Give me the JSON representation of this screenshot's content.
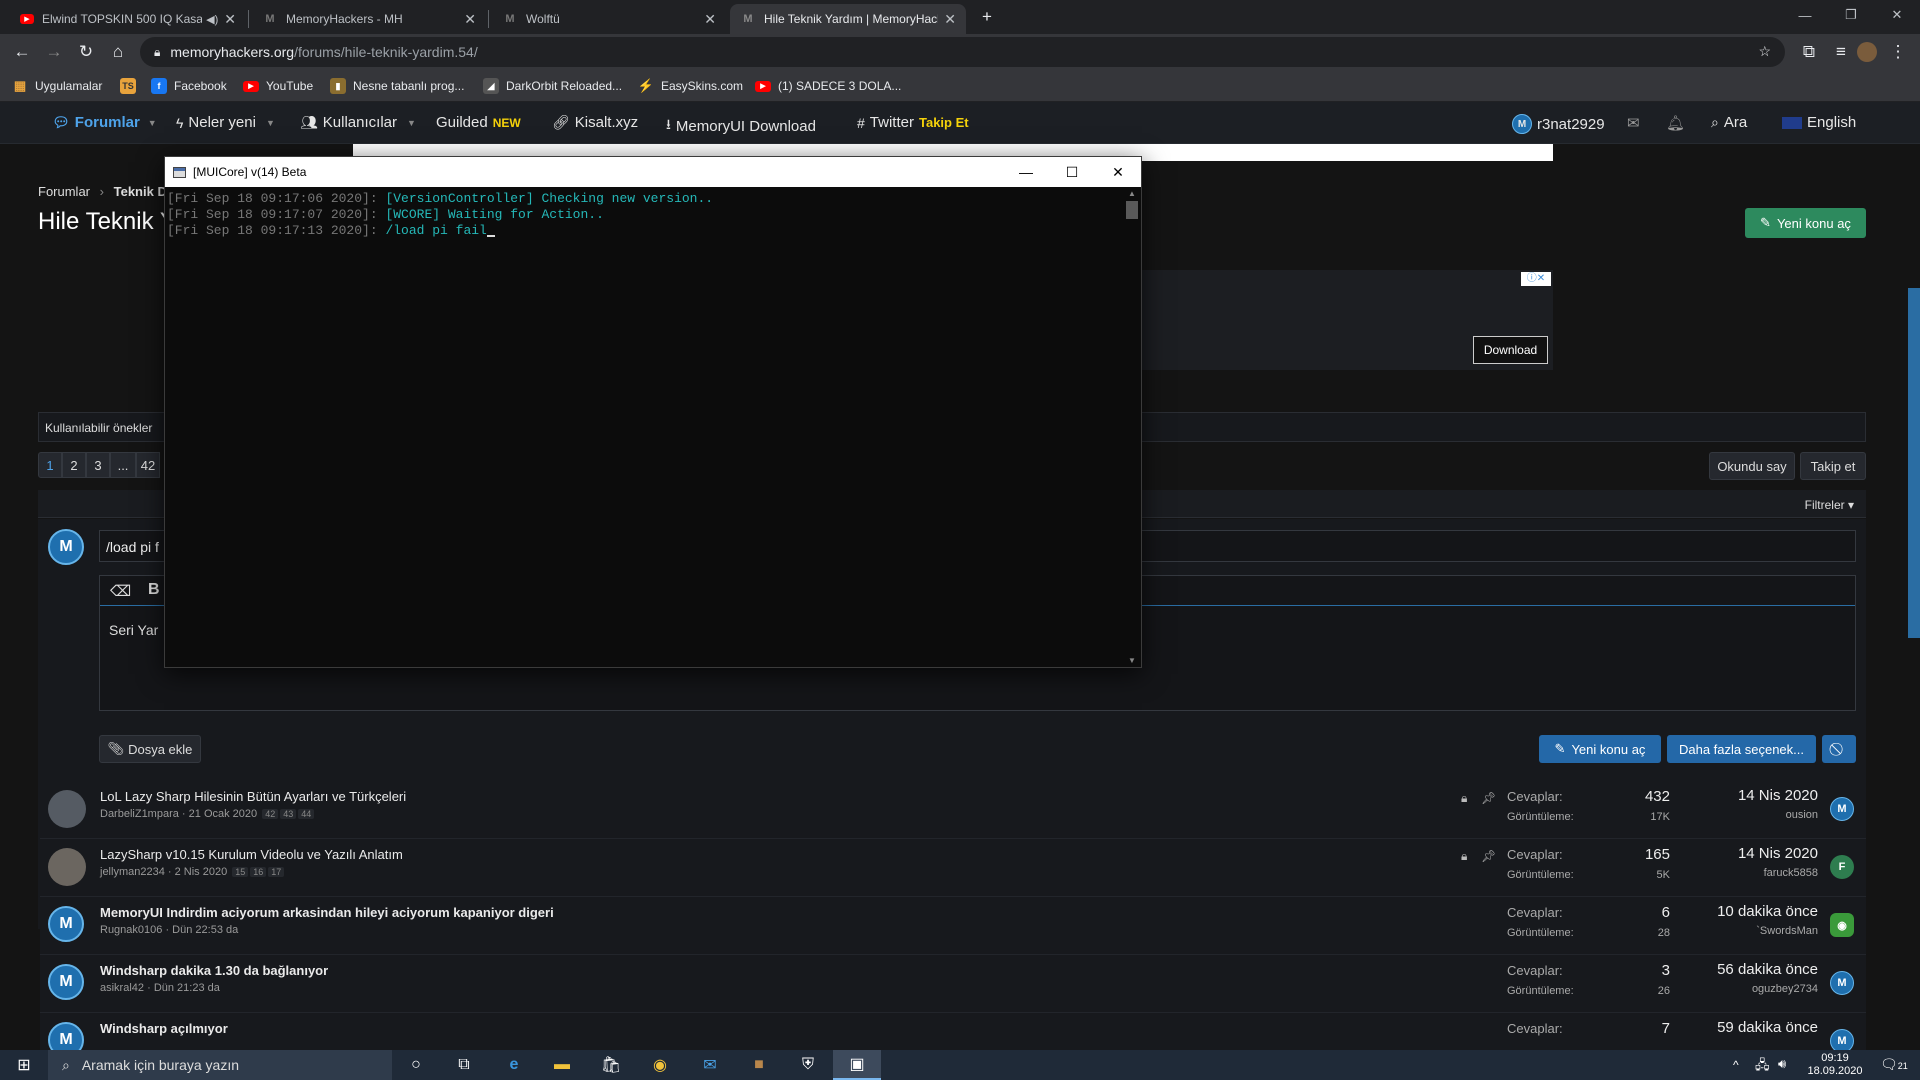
{
  "browser": {
    "tabs": [
      {
        "title": "Elwind TOPSKIN 500 IQ Kasa",
        "icon": "youtube-icon",
        "audio": true
      },
      {
        "title": "MemoryHackers - MH",
        "icon": "mh-icon"
      },
      {
        "title": "Wolftü",
        "icon": "mh-icon"
      },
      {
        "title": "Hile Teknik Yardım | MemoryHack",
        "icon": "mh-icon",
        "active": true
      }
    ],
    "url_host": "memoryhackers.org",
    "url_path": "/forums/hile-teknik-yardim.54/",
    "bookmarks": [
      {
        "label": "Uygulamalar",
        "icon": "apps-grid-icon",
        "color": "#e8a33c"
      },
      {
        "label": "",
        "icon": "ts-icon",
        "color": "#e8a33c"
      },
      {
        "label": "Facebook",
        "icon": "facebook-icon",
        "color": "#1877f2"
      },
      {
        "label": "YouTube",
        "icon": "youtube-icon",
        "color": "#ff0000"
      },
      {
        "label": "Nesne tabanlı prog...",
        "icon": "bookmark-icon",
        "color": "#8a6d2f"
      },
      {
        "label": "DarkOrbit Reloaded...",
        "icon": "darkorbit-icon",
        "color": "#7a7a7a"
      },
      {
        "label": "EasySkins.com",
        "icon": "easyskins-icon",
        "color": "#b7e23b"
      },
      {
        "label": "(1) SADECE 3 DOLA...",
        "icon": "youtube-icon",
        "color": "#ff0000"
      }
    ]
  },
  "site": {
    "nav": {
      "forums": "Forumlar",
      "whats_new": "Neler yeni",
      "members": "Kullanıcılar",
      "guilded": "Guilded",
      "guilded_badge": "NEW",
      "kisalt": "Kisalt.xyz",
      "download": "MemoryUI Download",
      "twitter": "Twitter",
      "twitter_follow": "Takip Et",
      "username": "r3nat2929",
      "search": "Ara",
      "language": "English"
    },
    "breadcrumb": {
      "first": "Forumlar",
      "second": "Teknik D"
    },
    "page_title": "Hile Teknik Y",
    "new_thread_button": "Yeni konu aç",
    "ad_download": "Download",
    "prefix_label": "Kullanılabilir önekler",
    "pagination": [
      "1",
      "2",
      "3",
      "...",
      "42"
    ],
    "mark_read": "Okundu say",
    "follow": "Takip et",
    "filters": "Filtreler",
    "quick_thread_title": "/load pi f",
    "editor_text": "Seri Yar",
    "attach_button": "Dosya ekle",
    "post_new_thread": "Yeni konu aç",
    "more_options": "Daha fazla seçenek...",
    "replies_label": "Cevaplar:",
    "views_label": "Görüntüleme:",
    "threads": [
      {
        "title": "LoL Lazy Sharp Hilesinin Bütün Ayarları ve Türkçeleri",
        "author": "DarbeliZ1mpara",
        "date": "21 Ocak 2020",
        "pages": [
          "42",
          "43",
          "44"
        ],
        "locked": true,
        "replies": "432",
        "views": "17K",
        "last_date": "14 Nis 2020",
        "last_user": "ousion",
        "bold": false,
        "avatar_color": "#555b63",
        "last_avatar": "M",
        "last_color": "#1f6fae"
      },
      {
        "title": "LazySharp v10.15 Kurulum Videolu ve Yazılı Anlatım",
        "author": "jellyman2234",
        "date": "2 Nis 2020",
        "pages": [
          "15",
          "16",
          "17"
        ],
        "locked": true,
        "replies": "165",
        "views": "5K",
        "last_date": "14 Nis 2020",
        "last_user": "faruck5858",
        "bold": false,
        "avatar_color": "#6b6660",
        "last_avatar": "F",
        "last_color": "#2e7d4f"
      },
      {
        "title": "MemoryUI Indirdim aciyorum arkasindan hileyi aciyorum kapaniyor digeri",
        "author": "Rugnak0106",
        "date": "Dün 22:53 da",
        "pages": [],
        "locked": false,
        "replies": "6",
        "views": "28",
        "last_date": "10 dakika önce",
        "last_user": "`SwordsMan",
        "bold": true,
        "avatar_color": "#1f6fae",
        "last_avatar": "",
        "last_color": "#3a9a3a"
      },
      {
        "title": "Windsharp dakika 1.30 da bağlanıyor",
        "author": "asikral42",
        "date": "Dün 21:23 da",
        "pages": [],
        "locked": false,
        "replies": "3",
        "views": "26",
        "last_date": "56 dakika önce",
        "last_user": "oguzbey2734",
        "bold": true,
        "avatar_color": "#1f6fae",
        "last_avatar": "M",
        "last_color": "#1f6fae"
      },
      {
        "title": "Windsharp açılmıyor",
        "author": "",
        "date": "",
        "pages": [],
        "locked": false,
        "replies": "7",
        "views": "",
        "last_date": "59 dakika önce",
        "last_user": "",
        "bold": true,
        "avatar_color": "#1f6fae",
        "last_avatar": "M",
        "last_color": "#1f6fae"
      }
    ]
  },
  "console": {
    "title": "[MUICore] v(14) Beta",
    "lines": [
      {
        "ts": "[Fri Sep 18 09:17:06 2020]: ",
        "msg": "[VersionController] Checking new version.."
      },
      {
        "ts": "[Fri Sep 18 09:17:07 2020]: ",
        "msg": "[WCORE] Waiting for Action.."
      },
      {
        "ts": "[Fri Sep 18 09:17:13 2020]: ",
        "msg": "/load pi fail"
      }
    ]
  },
  "taskbar": {
    "search_placeholder": "Aramak için buraya yazın",
    "time": "09:19",
    "date": "18.09.2020",
    "notifications": "21"
  }
}
